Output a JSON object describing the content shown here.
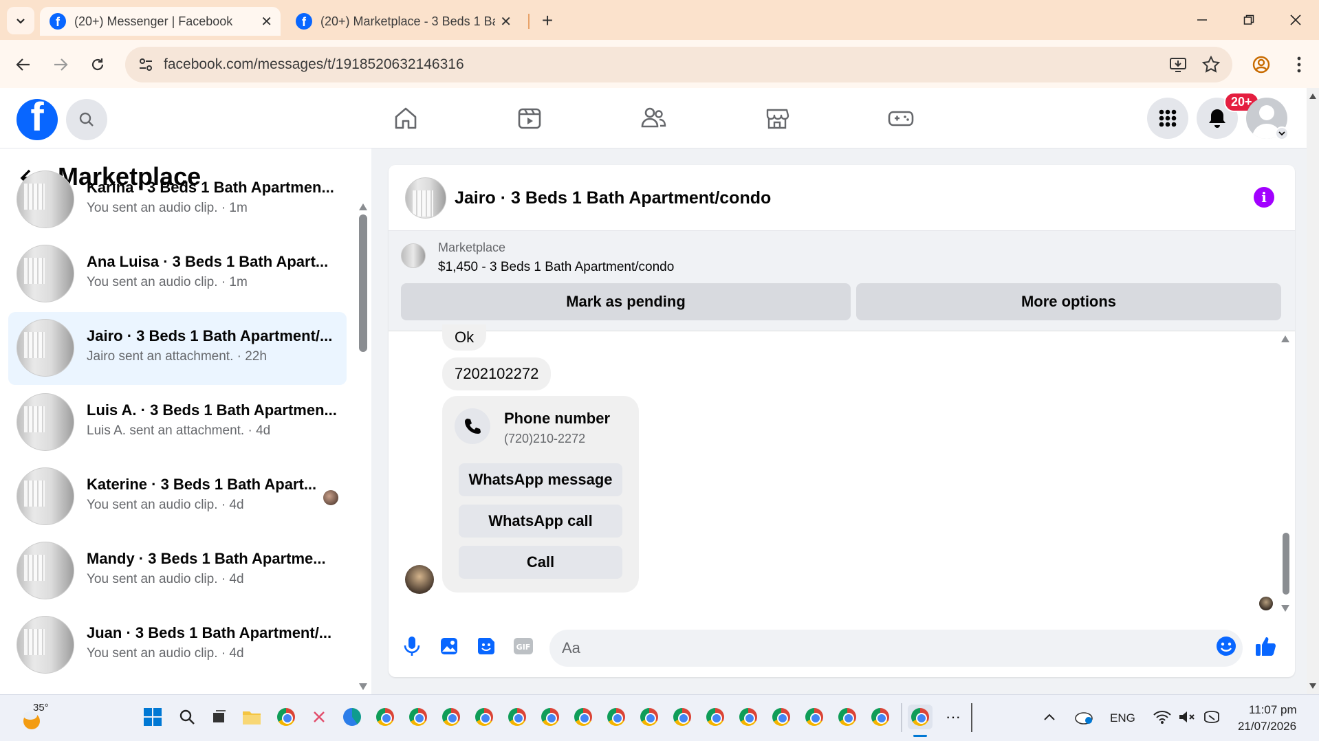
{
  "browser": {
    "tabs": [
      {
        "title": "(20+) Messenger | Facebook",
        "active": true
      },
      {
        "title": "(20+) Marketplace - 3 Beds 1 Ba",
        "active": false
      }
    ],
    "new_tab": "+",
    "url": "facebook.com/messages/t/1918520632146316"
  },
  "fb_header": {
    "logo": "f",
    "notifications_badge": "20+"
  },
  "sidebar": {
    "title": "Marketplace",
    "conversations": [
      {
        "name": "Karina · 3 Beds 1 Bath Apartmen...",
        "snippet": "You sent an audio clip. · 1m",
        "selected": false
      },
      {
        "name": "Ana Luisa · 3 Beds 1 Bath Apart...",
        "snippet": "You sent an audio clip. · 1m",
        "selected": false
      },
      {
        "name": "Jairo · 3 Beds 1 Bath Apartment/...",
        "snippet": "Jairo sent an attachment. · 22h",
        "selected": true
      },
      {
        "name": "Luis A. · 3 Beds 1 Bath Apartmen...",
        "snippet": "Luis A. sent an attachment. · 4d",
        "selected": false
      },
      {
        "name": "Katerine · 3 Beds 1 Bath Apart...",
        "snippet": "You sent an audio clip. · 4d",
        "selected": false
      },
      {
        "name": "Mandy · 3 Beds 1 Bath Apartme...",
        "snippet": "You sent an audio clip. · 4d",
        "selected": false
      },
      {
        "name": "Juan · 3 Beds 1 Bath Apartment/...",
        "snippet": "You sent an audio clip. · 4d",
        "selected": false
      }
    ]
  },
  "chat": {
    "title": "Jairo · 3 Beds 1 Bath Apartment/condo",
    "marketplace": {
      "label": "Marketplace",
      "item": "$1,450 - 3 Beds 1 Bath Apartment/condo",
      "mark_pending": "Mark as pending",
      "more_options": "More options"
    },
    "messages": [
      "Ok",
      "7202102272"
    ],
    "phone_card": {
      "title": "Phone number",
      "number": "(720)210-2272",
      "whatsapp_message": "WhatsApp message",
      "whatsapp_call": "WhatsApp call",
      "call": "Call"
    },
    "composer": {
      "placeholder": "Aa"
    }
  },
  "taskbar": {
    "weather": "35°",
    "language": "ENG",
    "time": "11:07 pm",
    "date": "21/07/2026",
    "more": "···"
  }
}
